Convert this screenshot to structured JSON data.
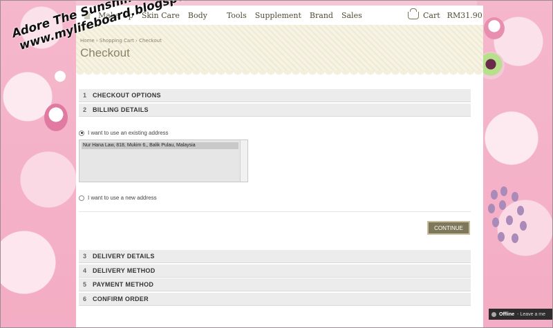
{
  "nav": {
    "items": [
      "Make Up",
      "Skin Care",
      "Body",
      "Tools",
      "Supplement",
      "Brand",
      "Sales"
    ],
    "cart_label": "Cart",
    "cart_total": "RM31.90"
  },
  "banner": {
    "breadcrumb": "Home › Shopping Cart › Checkout",
    "title": "Checkout"
  },
  "steps_top": [
    {
      "num": "1",
      "label": "CHECKOUT OPTIONS"
    },
    {
      "num": "2",
      "label": "BILLING DETAILS"
    }
  ],
  "billing": {
    "existing_label": "I want to use an existing address",
    "address_selected": "Nur Hana Law, 818, Mukim 6,, Balik Pulau, Malaysia",
    "new_label": "I want to use a new address",
    "continue_label": "CONTINUE"
  },
  "steps_bottom": [
    {
      "num": "3",
      "label": "DELIVERY DETAILS"
    },
    {
      "num": "4",
      "label": "DELIVERY METHOD"
    },
    {
      "num": "5",
      "label": "PAYMENT METHOD"
    },
    {
      "num": "6",
      "label": "CONFIRM ORDER"
    }
  ],
  "watermark": {
    "line1": "Adore The Sunshine",
    "line2": "www.mylifeboard.blogspot.com"
  },
  "chat": {
    "status": "Offline",
    "text": "- Leave a me"
  }
}
